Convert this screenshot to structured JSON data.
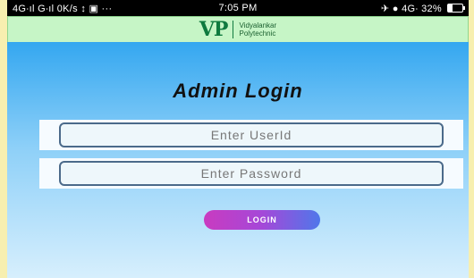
{
  "status_bar": {
    "left_text": "4G∙ıl G∙ıl 0K/s ↕ ▣ ···",
    "time": "7:05 PM",
    "right_text": "✈ ● 4G∙ 32%",
    "battery_level": 0.32
  },
  "app_bar": {
    "logo_mark": "VP",
    "logo_line1": "Vidyalankar",
    "logo_line2": "Polytechnic"
  },
  "login": {
    "title": "Admin Login",
    "userid_placeholder": "Enter UserId",
    "password_placeholder": "Enter Password",
    "button_label": "LOGIN"
  },
  "colors": {
    "app_bar_bg": "#c6f5c6",
    "logo": "#0f7a3f",
    "screen_gradient_top": "#34a7f0",
    "button_gradient_start": "#c93bc0",
    "button_gradient_end": "#4f77ea"
  }
}
